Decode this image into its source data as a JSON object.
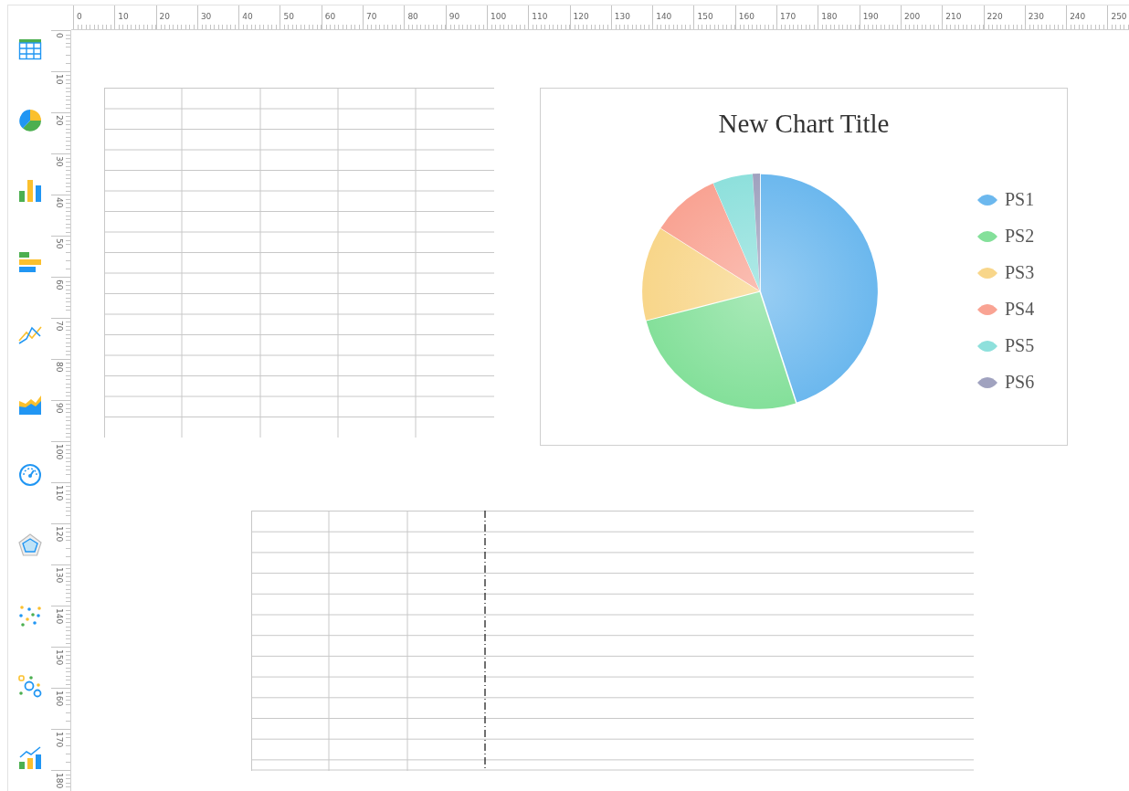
{
  "top_ruler": {
    "labels": [
      "0",
      "10",
      "20",
      "30",
      "40",
      "50",
      "60",
      "70",
      "80",
      "90",
      "100",
      "110",
      "120",
      "130",
      "140",
      "150",
      "160",
      "170",
      "180",
      "190",
      "200",
      "210",
      "220",
      "230",
      "240",
      "250"
    ]
  },
  "left_ruler": {
    "labels": [
      "0",
      "10",
      "20",
      "30",
      "40",
      "50",
      "60",
      "70",
      "80",
      "90",
      "100",
      "110",
      "120",
      "130",
      "140",
      "150",
      "160",
      "170",
      "180"
    ]
  },
  "chart": {
    "chart_data": {
      "type": "pie",
      "title": "New Chart Title",
      "categories": [
        "PS1",
        "PS2",
        "PS3",
        "PS4",
        "PS5",
        "PS6"
      ],
      "values": [
        45,
        26,
        13,
        9.5,
        5.5,
        1
      ],
      "colors": [
        "#6cb8ee",
        "#84e09a",
        "#f8d68a",
        "#f9a393",
        "#8ee0dc",
        "#a0a2bf"
      ],
      "legend": true
    }
  }
}
